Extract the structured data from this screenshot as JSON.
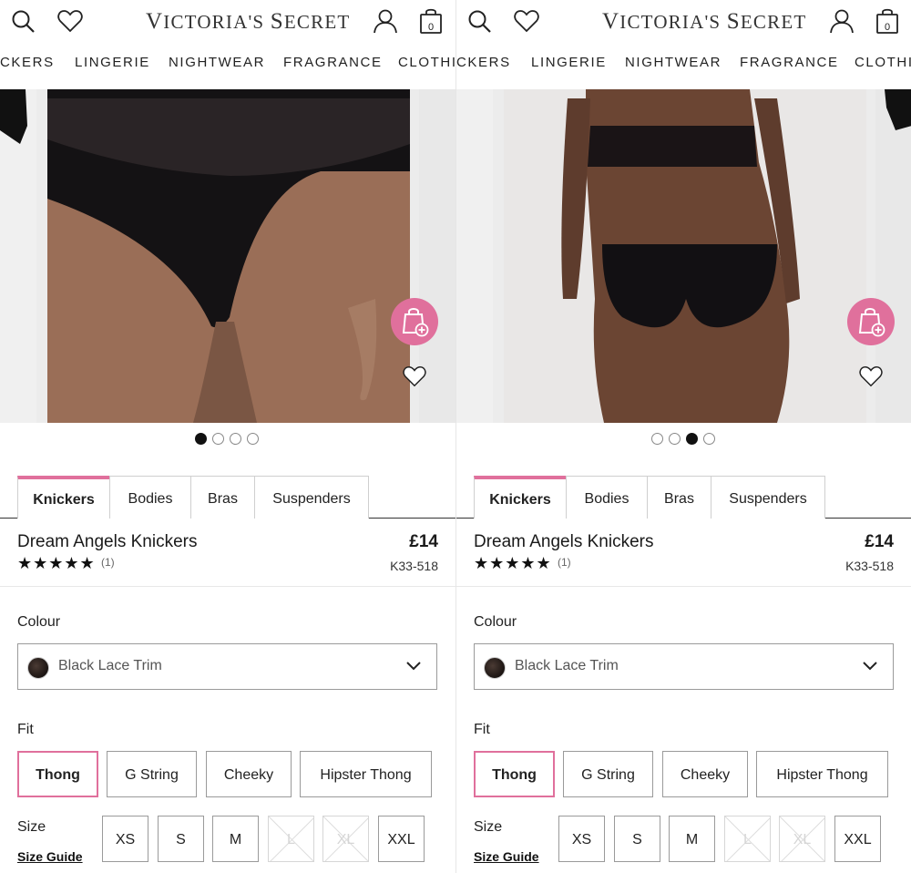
{
  "header": {
    "brand_first": "V",
    "brand_rest_1": "ICTORIA",
    "brand_apos": "'S ",
    "brand_s": "S",
    "brand_rest_2": "ECRET",
    "bag_count": "0"
  },
  "nav": {
    "left": [
      "CKERS",
      "LINGERIE",
      "NIGHTWEAR",
      "FRAGRANCE",
      "CLOTHI"
    ],
    "right": [
      "CKERS",
      "LINGERIE",
      "NIGHTWEAR",
      "FRAGRANCE",
      "CLOTHI"
    ]
  },
  "carousel": {
    "left_active_index": 0,
    "right_active_index": 2,
    "count": 4
  },
  "tabs": [
    "Knickers",
    "Bodies",
    "Bras",
    "Suspenders"
  ],
  "product": {
    "name": "Dream Angels Knickers",
    "price": "£14",
    "stars": "★★★★★",
    "rating": 5,
    "review_count": "(1)",
    "sku": "K33-518"
  },
  "colour": {
    "label": "Colour",
    "selected": "Black Lace Trim"
  },
  "fit": {
    "label": "Fit",
    "options": [
      "Thong",
      "G String",
      "Cheeky",
      "Hipster Thong"
    ],
    "selected": "Thong"
  },
  "size": {
    "label": "Size",
    "guide_label": "Size Guide",
    "options": [
      "XS",
      "S",
      "M",
      "L",
      "XL",
      "XXL"
    ],
    "unavailable": [
      "L",
      "XL"
    ]
  },
  "colors": {
    "accent": "#e0709c",
    "text": "#1a1a1a"
  }
}
